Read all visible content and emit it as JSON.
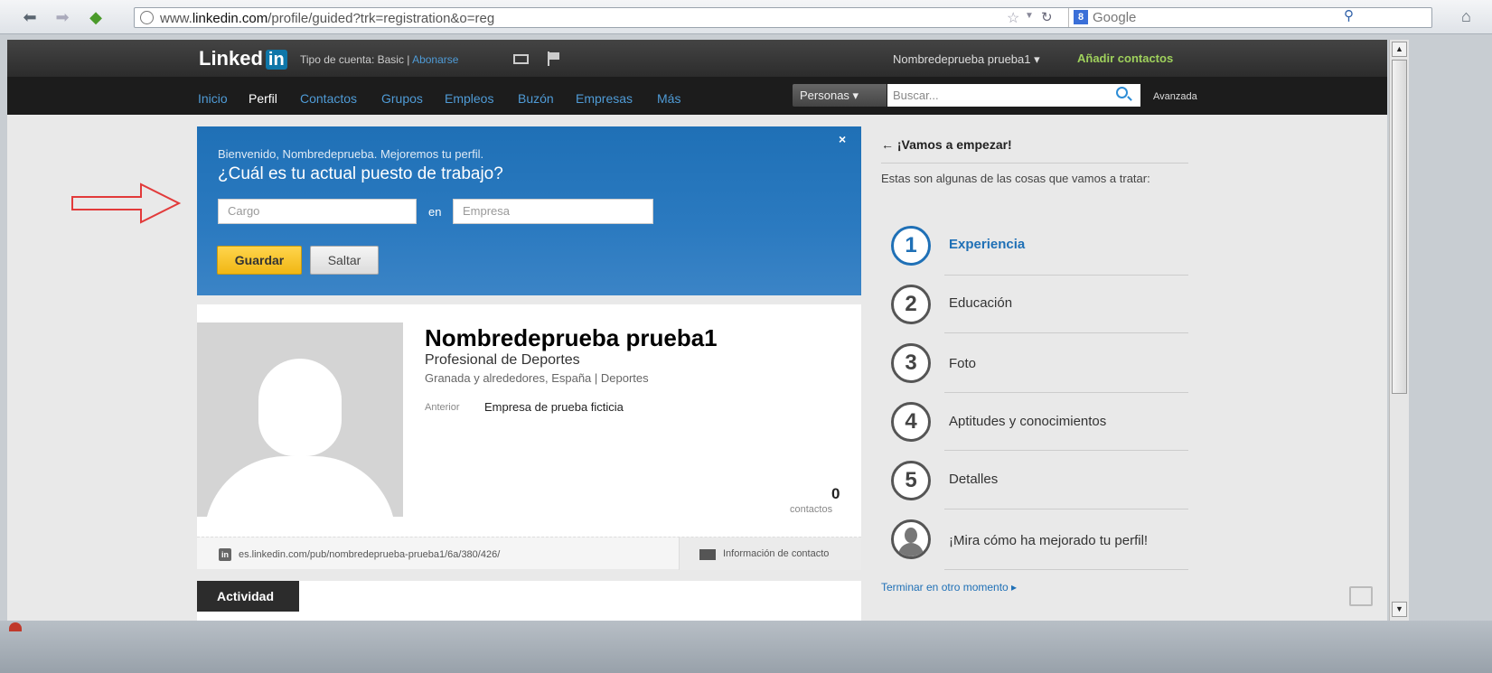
{
  "browser": {
    "url_prefix": "www.",
    "url_domain": "linkedin.com",
    "url_path": "/profile/guided?trk=registration&o=reg",
    "search_engine": "Google",
    "search_logo": "8"
  },
  "topbar": {
    "logo_text": "Linked",
    "logo_in": "in",
    "account_label": "Tipo de cuenta: Basic | ",
    "upgrade_link": "Abonarse",
    "user_menu": "Nombredeprueba prueba1 ▾",
    "add_contacts": "Añadir contactos"
  },
  "nav": {
    "items": [
      "Inicio",
      "Perfil",
      "Contactos",
      "Grupos",
      "Empleos",
      "Buzón",
      "Empresas",
      "Más"
    ],
    "search_type": "Personas ▾",
    "search_placeholder": "Buscar...",
    "advanced": "Avanzada"
  },
  "welcome": {
    "close": "×",
    "intro": "Bienvenido, Nombredeprueba. Mejoremos tu perfil.",
    "question": "¿Cuál es tu actual puesto de trabajo?",
    "cargo_placeholder": "Cargo",
    "en": "en",
    "empresa_placeholder": "Empresa",
    "save": "Guardar",
    "skip": "Saltar"
  },
  "profile": {
    "name": "Nombredeprueba prueba1",
    "headline": "Profesional de Deportes",
    "location": "Granada y alrededores, España | Deportes",
    "previous_label": "Anterior",
    "previous_value": "Empresa de prueba ficticia",
    "connections_count": "0",
    "connections_label": "contactos",
    "public_url": "es.linkedin.com/pub/nombredeprueba-prueba1/6a/380/426/",
    "contact_info": "Información de contacto",
    "activity_tab": "Actividad"
  },
  "guide": {
    "title": "← ¡Vamos a empezar!",
    "description": "Estas son algunas de las cosas que vamos a tratar:",
    "steps": [
      {
        "number": "1",
        "label": "Experiencia"
      },
      {
        "number": "2",
        "label": "Educación"
      },
      {
        "number": "3",
        "label": "Foto"
      },
      {
        "number": "4",
        "label": "Aptitudes y conocimientos"
      },
      {
        "number": "5",
        "label": "Detalles"
      }
    ],
    "final_step": "¡Mira cómo ha mejorado tu perfil!",
    "finish_later": "Terminar en otro momento ▸"
  },
  "colors": {
    "linkedin_blue": "#1f70b6",
    "save_yellow": "#f1b714",
    "add_contacts_green": "#9fd15c",
    "annotation_arrow": "#e23a3a"
  }
}
